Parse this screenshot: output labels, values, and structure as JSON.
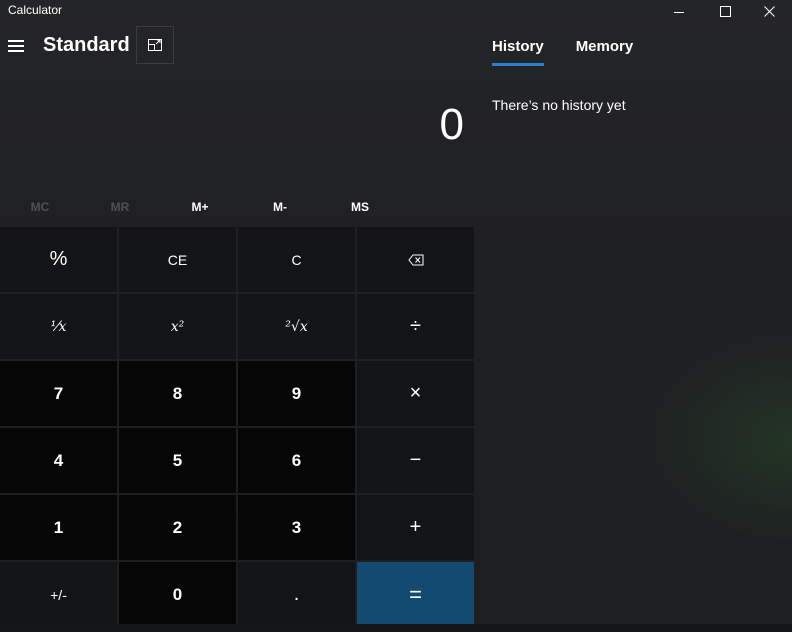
{
  "window": {
    "title": "Calculator"
  },
  "header": {
    "mode_title": "Standard"
  },
  "display": {
    "value": "0"
  },
  "memory": {
    "buttons": [
      {
        "label": "MC",
        "enabled": false
      },
      {
        "label": "MR",
        "enabled": false
      },
      {
        "label": "M+",
        "enabled": true
      },
      {
        "label": "M-",
        "enabled": true
      },
      {
        "label": "MS",
        "enabled": true
      }
    ]
  },
  "keypad": {
    "percent": "%",
    "ce": "CE",
    "c": "C",
    "one_over_x": "⅟x",
    "square": "x²",
    "sqrt": "²√x",
    "divide": "÷",
    "seven": "7",
    "eight": "8",
    "nine": "9",
    "multiply": "×",
    "four": "4",
    "five": "5",
    "six": "6",
    "minus": "−",
    "one": "1",
    "two": "2",
    "three": "3",
    "plus": "+",
    "negate": "+/-",
    "zero": "0",
    "decimal": ".",
    "equals": "="
  },
  "side_panel": {
    "tabs": [
      {
        "label": "History",
        "active": true
      },
      {
        "label": "Memory",
        "active": false
      }
    ],
    "history_empty": "There’s no history yet"
  },
  "colors": {
    "accent": "#2a7fd4",
    "equals_bg": "#134a70"
  }
}
